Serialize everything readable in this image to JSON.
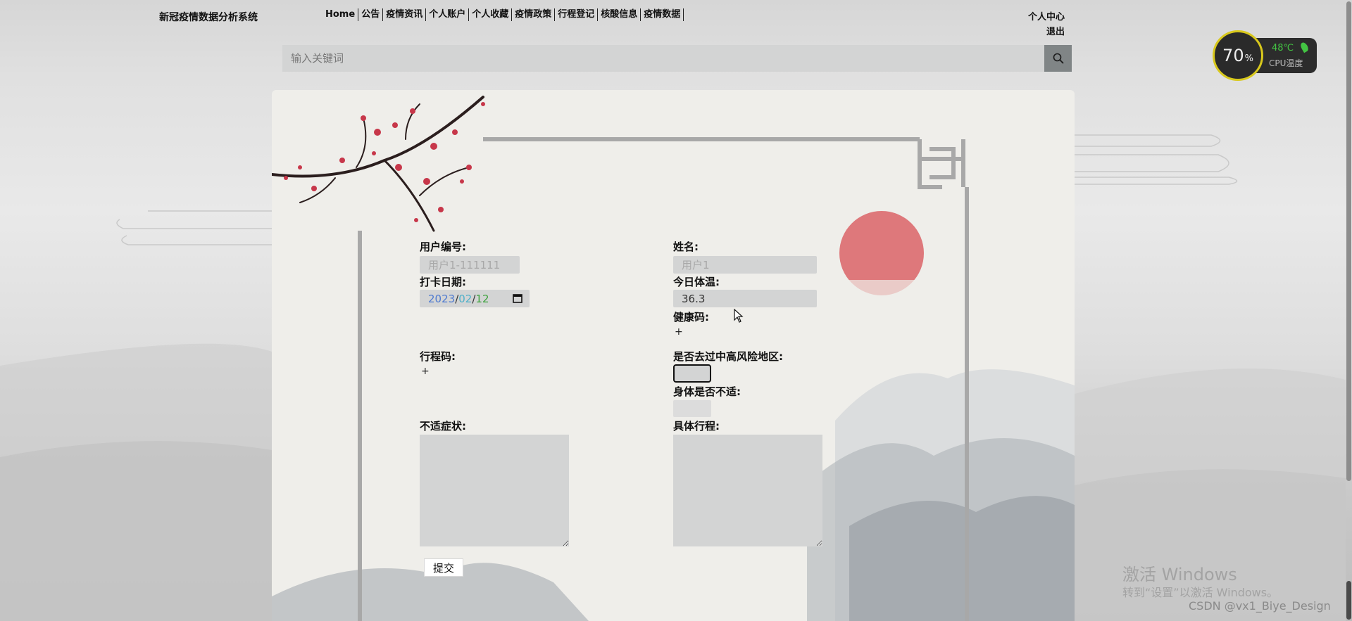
{
  "header": {
    "brand": "新冠疫情数据分析系统",
    "nav": [
      "Home",
      "公告",
      "疫情资讯",
      "个人账户",
      "个人收藏",
      "疫情政策",
      "行程登记",
      "核酸信息",
      "疫情数据"
    ],
    "user_center": "个人中心",
    "logout": "退出"
  },
  "search": {
    "placeholder": "输入关键词",
    "icon": "search-icon"
  },
  "form": {
    "user_id_label": "用户编号:",
    "user_id_placeholder": "用户1-111111",
    "name_label": "姓名:",
    "name_placeholder": "用户1",
    "date_label": "打卡日期:",
    "date_year": "2023",
    "date_month": "02",
    "date_day": "12",
    "date_sep": "/",
    "temp_label": "今日体温:",
    "temp_value": "36.3",
    "health_code_label": "健康码:",
    "plus": "+",
    "travel_code_label": "行程码:",
    "high_risk_label": "是否去过中高风险地区:",
    "unwell_label": "身体是否不适:",
    "symptoms_label": "不适症状:",
    "itinerary_label": "具体行程:",
    "submit_label": "提交"
  },
  "cpu_widget": {
    "percent": "70",
    "percent_unit": "%",
    "temp": "48℃",
    "label": "CPU温度"
  },
  "watermark": {
    "title": "激活 Windows",
    "subtitle": "转到“设置”以激活 Windows。",
    "csdn": "CSDN @vx1_Biye_Design"
  },
  "colors": {
    "field_bg": "#d3d4d4",
    "search_button": "#808586",
    "panel_bg": "#efeeea",
    "cpu_ring": "#d8c81c",
    "cpu_temp": "#43c443"
  }
}
